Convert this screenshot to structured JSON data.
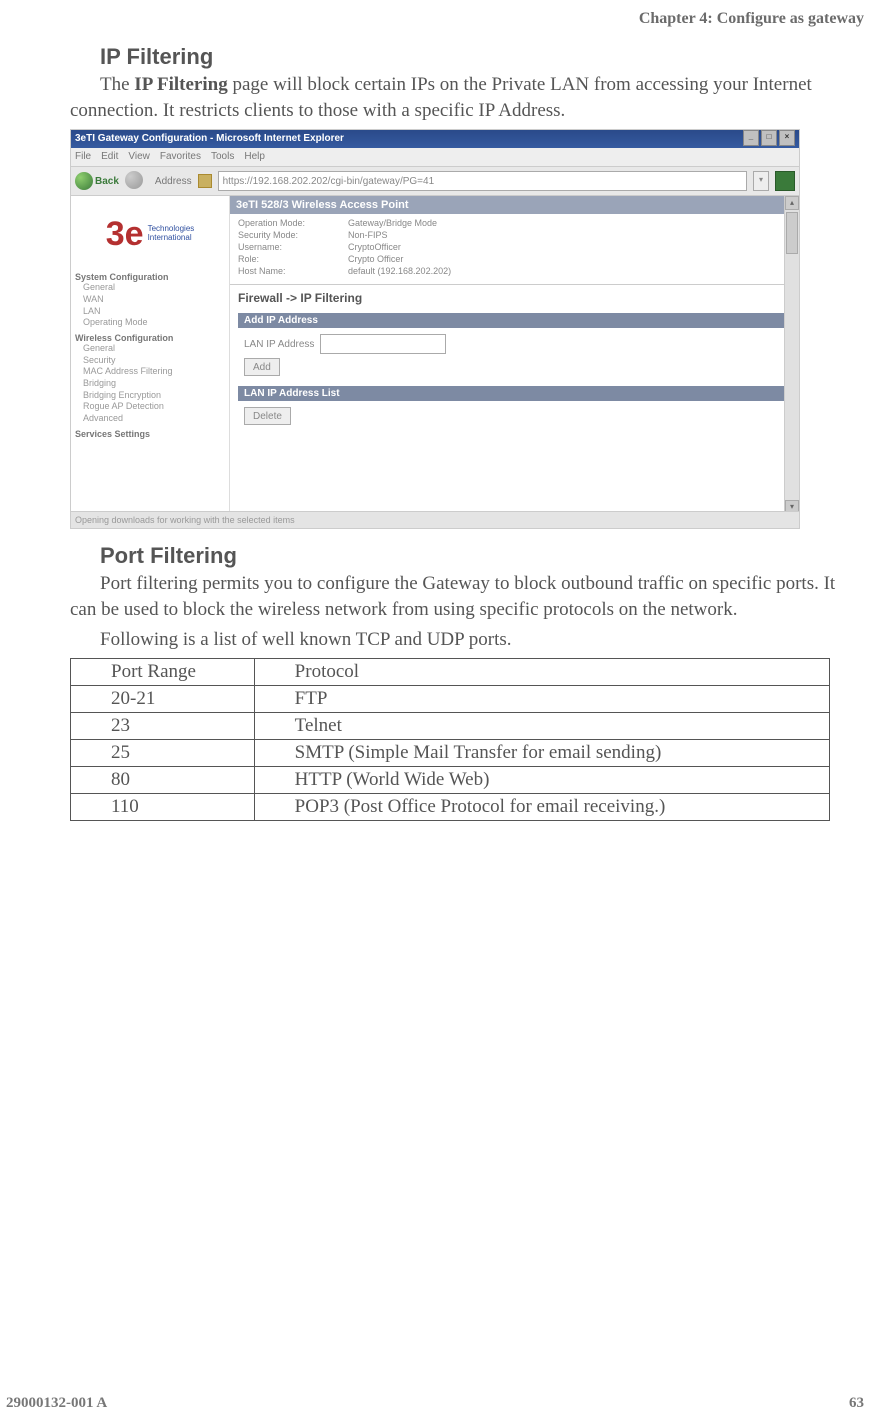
{
  "chapter_header": "Chapter 4: Configure as gateway",
  "section1": {
    "title": "IP Filtering",
    "para_pre": "The ",
    "para_bold": "IP Filtering",
    "para_post": " page will block certain IPs on the Private LAN from accessing your Internet connection. It restricts clients to those with a specific IP Address."
  },
  "screenshot": {
    "title": "3eTI Gateway Configuration - Microsoft Internet Explorer",
    "menus": [
      "File",
      "Edit",
      "View",
      "Favorites",
      "Tools",
      "Help"
    ],
    "back_label": "Back",
    "address_label": "Address",
    "address_value": "https://192.168.202.202/cgi-bin/gateway/PG=41",
    "panel_title": "3eTI 528/3 Wireless Access Point",
    "info": [
      [
        "Operation Mode:",
        "Gateway/Bridge Mode"
      ],
      [
        "Security Mode:",
        "Non-FIPS"
      ],
      [
        "Username:",
        "CryptoOfficer"
      ],
      [
        "Role:",
        "Crypto Officer"
      ],
      [
        "Host Name:",
        "default (192.168.202.202)"
      ]
    ],
    "breadcrumb": "Firewall -> IP Filtering",
    "add_panel_title": "Add IP Address",
    "add_field_label": "LAN IP Address",
    "add_button": "Add",
    "list_panel_title": "LAN IP Address List",
    "delete_button": "Delete",
    "nav": {
      "group1": "System Configuration",
      "items1": [
        "General",
        "WAN",
        "LAN",
        "Operating Mode"
      ],
      "group2": "Wireless Configuration",
      "items2": [
        "General",
        "Security",
        "MAC Address Filtering",
        "Bridging",
        "Bridging Encryption",
        "Rogue AP Detection",
        "Advanced"
      ],
      "group3": "Services Settings"
    },
    "statusbar": "Opening downloads for working with the selected items"
  },
  "section2": {
    "title": "Port Filtering",
    "para1": "Port filtering permits you to configure the Gateway to block outbound traffic on specific ports. It can be used to block the wireless network from using specific protocols on the network.",
    "para2": "Following is a list of well known TCP and UDP ports."
  },
  "table": {
    "headers": [
      "Port Range",
      "Protocol"
    ],
    "rows": [
      [
        "20-21",
        "FTP"
      ],
      [
        "23",
        "Telnet"
      ],
      [
        "25",
        "SMTP (Simple Mail Transfer for email sending)"
      ],
      [
        "80",
        "HTTP (World Wide Web)"
      ],
      [
        "110",
        "POP3 (Post Office Protocol for email receiving.)"
      ]
    ]
  },
  "footer": {
    "left": "29000132-001 A",
    "right": "63"
  }
}
